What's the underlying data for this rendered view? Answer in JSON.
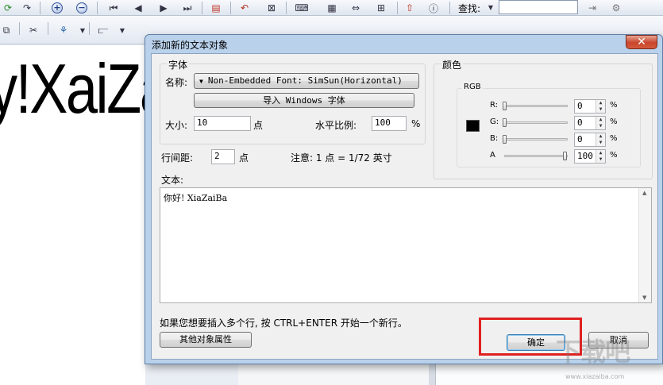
{
  "toolbar": {
    "find_label": "查找:",
    "find_value": ""
  },
  "canvas": {
    "preview_text": "y!XaiZa"
  },
  "dialog": {
    "title": "添加新的文本对象",
    "close_glyph": "✕",
    "font_group": {
      "title": "字体",
      "name_label": "名称:",
      "font_select": "Non-Embedded Font: SimSun(Horizontal)",
      "import_button": "导入 Windows 字体",
      "size_label": "大小:",
      "size_value": "10",
      "size_unit": "点",
      "scale_label": "水平比例:",
      "scale_value": "100",
      "scale_unit": "%"
    },
    "line_spacing_label": "行间距:",
    "line_spacing_value": "2",
    "line_spacing_unit": "点",
    "note": "注意: 1 点 = 1/72 英寸",
    "color_group": {
      "title": "颜色",
      "mode": "RGB",
      "swatch_color": "#000000",
      "channels": [
        {
          "label": "R:",
          "value": "0",
          "unit": "%",
          "level": 0
        },
        {
          "label": "G:",
          "value": "0",
          "unit": "%",
          "level": 0
        },
        {
          "label": "B:",
          "value": "0",
          "unit": "%",
          "level": 0
        },
        {
          "label": "A",
          "value": "100",
          "unit": "%",
          "level": 1
        }
      ]
    },
    "text_label": "文本:",
    "text_value": "你好! XiaZaiBa",
    "hint": "如果您想要插入多个行, 按 CTRL+ENTER 开始一个新行。",
    "other_props_button": "其他对象属性",
    "ok_button": "确定",
    "cancel_button": "取消"
  },
  "watermark": {
    "text": "下载吧",
    "url": "www.xiazaiba.com"
  },
  "colors": {
    "highlight": "#e02020",
    "dialog_frame": "#b9d1ea"
  }
}
